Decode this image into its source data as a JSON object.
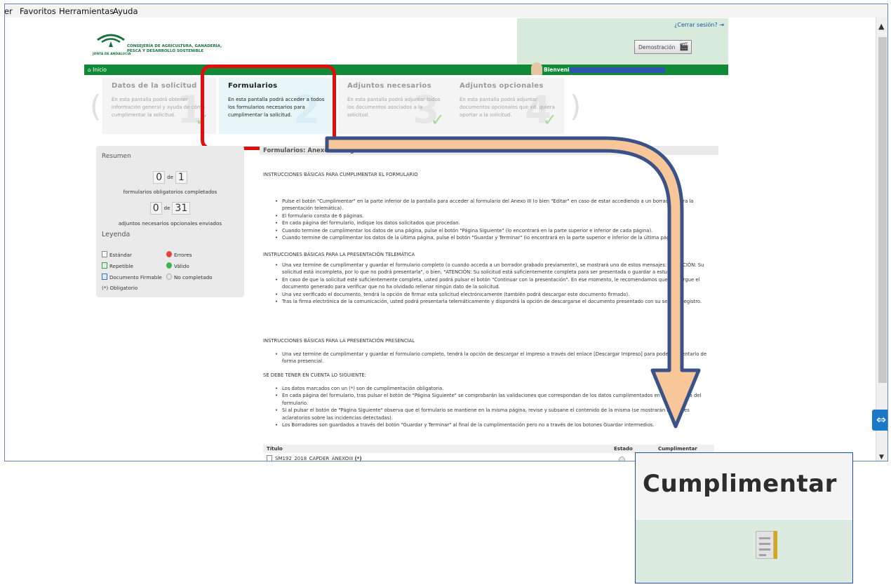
{
  "menubar": {
    "items": [
      "er",
      "Favoritos",
      "Herramientas",
      "Ayuda"
    ]
  },
  "header": {
    "logo_org_line1": "CONSEJERÍA DE AGRICULTURA, GANADERÍA,",
    "logo_org_line2": "PESCA Y DESARROLLO SOSTENIBLE",
    "logo_jda": "JUNTA DE ANDALUCIA",
    "logout": "¿Cerrar sesión?",
    "demo_button": "Demostración",
    "home": "Inicio",
    "welcome": "Bienvenid"
  },
  "steps": [
    {
      "title": "Datos de la solicitud",
      "desc": "En esta pantalla podrá obtener información general y ayuda de cómo cumplimentar la solicitud.",
      "num": "1",
      "active": false
    },
    {
      "title": "Formularios",
      "desc": "En esta pantalla podrá acceder a todos los formularios necesarios para cumplimentar la solicitud.",
      "num": "2",
      "active": true
    },
    {
      "title": "Adjuntos necesarios",
      "desc": "En esta pantalla podrá adjuntar todos los documentos asociados a la solicitud.",
      "num": "3",
      "active": false
    },
    {
      "title": "Adjuntos opcionales",
      "desc": "En esta pantalla podrá adjuntar documentos opcionales que vd. quiera aportar a la solicitud.",
      "num": "4",
      "active": false
    }
  ],
  "summary": {
    "title": "Resumen",
    "forms_done": "0",
    "forms_total": "1",
    "de": "de",
    "forms_caption": "formularios obligatorios completados",
    "att_done": "0",
    "att_total": "31",
    "att_caption": "adjuntos necesarios opcionales enviados",
    "legend_title": "Leyenda",
    "legend": {
      "standard": "Estándar",
      "errors": "Errores",
      "repeatable": "Repetible",
      "valid": "Válido",
      "signable": "Documento Firmable",
      "not_completed": "No completado",
      "mandatory": "(*) Obligatorio"
    }
  },
  "content": {
    "title": "Formularios: Anexo III Alegaciones submedida 19.2 2018",
    "sec1_title": "INSTRUCCIONES BÁSICAS PARA CUMPLIMENTAR EL FORMULARIO",
    "sec1": [
      "Pulse el botón \"Cumplimentar\" en la parte inferior de la pantalla para acceder al formulario del Anexo III (o bien \"Editar\" en caso de estar accediendo a un borrador) para la presentación telemática).",
      "El formulario consta de 6 páginas.",
      "En cada página del formulario, indique los datos solicitados que procedan.",
      "Cuando termine de cumplimentar los datos de una página, pulse el botón \"Página Siguiente\" (lo encontrará en la parte superior e inferior de cada página).",
      "Cuando termine de cumplimentar los datos de la última página, pulse el botón \"Guardar y Terminar\" (lo encontrará en la parte superior e inferior de la última página)."
    ],
    "sec2_title": "INSTRUCCIONES BÁSICAS PARA LA PRESENTACIÓN TELEMÁTICA",
    "sec2": [
      "Una vez termine de cumplimentar y guardar el formulario completo (o cuando acceda a un borrador grabado previamente), se mostrará uno de estos mensajes: \"ATENCIÓN: Su solicitud está incompleta, por lo que no podrá presentarla\", o bien, \"ATENCIÓN: Su solicitud está suficientemente completa para ser presentada o guardar a estudio\".",
      "En caso de que la solicitud esté suficientemente completa, usted podrá pulsar el botón \"Continuar con la presentación\". En ese momento, le recomendamos que descargue el documento generado para verificar que no ha olvidado rellenar ningún dato de la solicitud.",
      "Una vez verificado el documento, tendrá la opción de firmar esta solicitud electrónicamente (también podrá descargar este documento firmado).",
      "Tras la firma electrónica de la comunicación, usted podrá presentarla telemáticamente y dispondrá la opción de descargarse el documento presentado con su sello de registro."
    ],
    "sec3_title": "INSTRUCCIONES BÁSICAS PARA LA PRESENTACIÓN PRESENCIAL",
    "sec3": [
      "Una vez termine de cumplimentar y guardar el formulario completo, tendrá la opción de descargar el impreso a través del enlace [Descargar Impreso] para poder presentarlo de forma presencial."
    ],
    "sec4_title": "SE DEBE TENER EN CUENTA LO SIGUIENTE:",
    "sec4": [
      "Los datos marcados con un (*) son de cumplimentación obligatoria.",
      "En cada página del formulario, tras pulsar el botón de \"Página Siguiente\" se comprobarán las validaciones que correspondan de los datos cumplimentados en dicha página del formulario.",
      "Si al pulsar el botón de \"Página Siguiente\" observa que el formulario se mantiene en la misma página, revise y subsane el contenido de la misma (se mostrarán mensajes aclaratorios sobre las incidencias detectadas).",
      "Los Borradores son guardados a través del botón \"Guardar y Terminar\" al final de la cumplimentación pero no a través de los botones Guardar intermedios."
    ],
    "table_headers": {
      "title": "Título",
      "status": "Estado",
      "fill": "Cumplimentar"
    },
    "table_row": {
      "name": "SM192_2018_CAPDER_ANEXOIII",
      "mandatory": "(*)"
    }
  },
  "zoom": {
    "title": "Cumplimentar"
  },
  "colors": {
    "brand_green": "#108a36",
    "highlight_red": "#e20e0e",
    "arrow_fill": "#f7c79a",
    "arrow_stroke": "#3a5288"
  }
}
